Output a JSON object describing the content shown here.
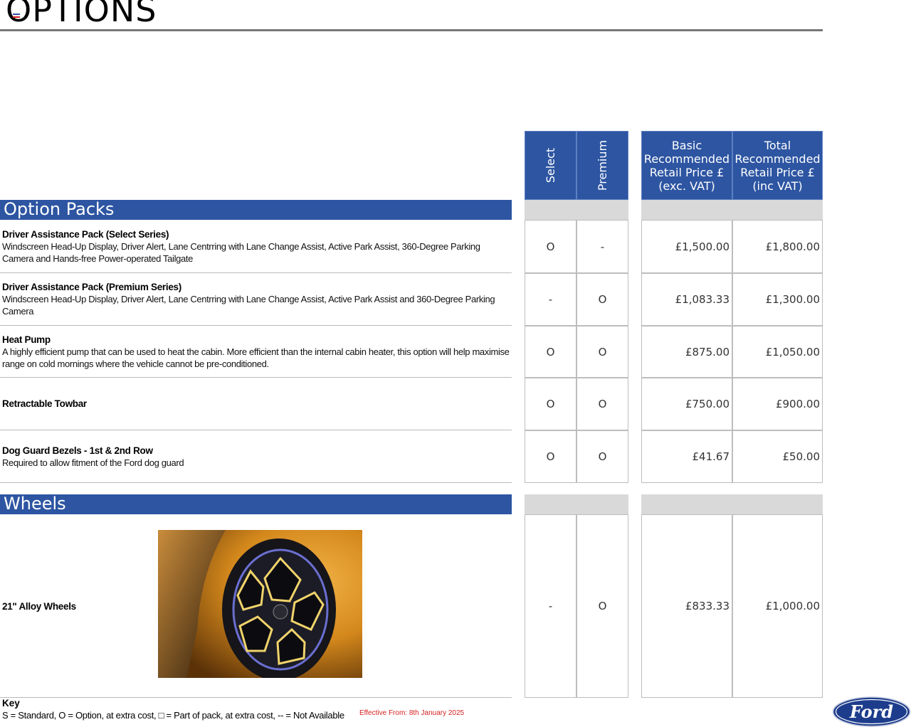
{
  "page": {
    "title": "OPTIONS"
  },
  "table_header": {
    "select": "Select",
    "premium": "Premium",
    "basic_price": "Basic\nRecommended\nRetail Price  £\n(exc. VAT)",
    "total_price": "Total\nRecommended\nRetail Price £\n(inc VAT)"
  },
  "sections": {
    "option_packs": "Option Packs",
    "wheels": "Wheels"
  },
  "option_packs": [
    {
      "name": "Driver Assistance Pack (Select Series)",
      "desc": "Windscreen Head-Up Display, Driver Alert, Lane Centrring with Lane Change Assist, Active Park Assist, 360-Degree Parking Camera and Hands-free Power-operated Tailgate",
      "select": "O",
      "premium": "-",
      "basic": "£1,500.00",
      "total": "£1,800.00"
    },
    {
      "name": "Driver Assistance Pack (Premium Series)",
      "desc": "Windscreen Head-Up Display, Driver Alert, Lane Centrring with Lane Change Assist, Active Park Assist and 360-Degree Parking Camera",
      "select": "-",
      "premium": "O",
      "basic": "£1,083.33",
      "total": "£1,300.00"
    },
    {
      "name": "Heat Pump",
      "desc": "A highly efficient pump that can be used to heat the cabin. More efficient than the internal cabin heater, this option will help maximise range on cold mornings where the vehicle cannot be pre-conditioned.",
      "select": "O",
      "premium": "O",
      "basic": "£875.00",
      "total": "£1,050.00"
    },
    {
      "name": "Retractable Towbar",
      "desc": "",
      "select": "O",
      "premium": "O",
      "basic": "£750.00",
      "total": "£900.00"
    },
    {
      "name": "Dog Guard Bezels - 1st & 2nd Row",
      "desc": "Required to allow fitment of the Ford dog guard",
      "select": "O",
      "premium": "O",
      "basic": "£41.67",
      "total": "£50.00"
    }
  ],
  "wheels": [
    {
      "name": "21\" Alloy Wheels",
      "select": "-",
      "premium": "O",
      "basic": "£833.33",
      "total": "£1,000.00"
    }
  ],
  "footer": {
    "key_title": "Key",
    "key_text": "S = Standard, O = Option, at extra cost, □ = Part of pack, at extra cost, -- = Not Available",
    "effective": "Effective From: 8th January 2025",
    "logo_text": "Ford"
  },
  "colors": {
    "header_blue": "#2d55a2",
    "band_grey": "#d9d9d9",
    "effective_red": "#d62020"
  },
  "icons": {
    "title_mark": "flag-icon",
    "logo": "ford-oval-logo"
  }
}
